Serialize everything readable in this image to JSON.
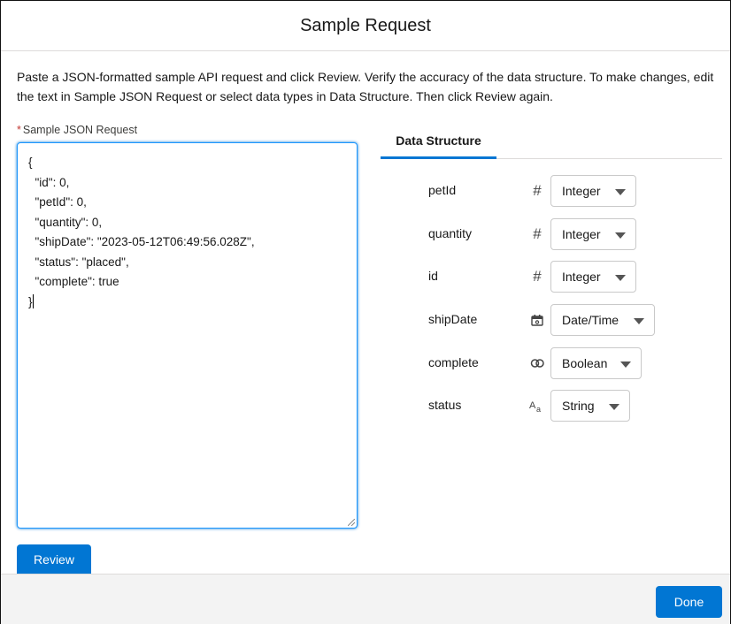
{
  "modal": {
    "title": "Sample Request",
    "instructions": "Paste a JSON-formatted sample API request and click Review. Verify the accuracy of the data structure. To make changes, edit the text in Sample JSON Request or select data types in Data Structure. Then click Review again."
  },
  "json_field": {
    "required_marker": "*",
    "label": "Sample JSON Request",
    "value": "{\n  \"id\": 0,\n  \"petId\": 0,\n  \"quantity\": 0,\n  \"shipDate\": \"2023-05-12T06:49:56.028Z\",\n  \"status\": \"placed\",\n  \"complete\": true\n}"
  },
  "tabs": [
    {
      "label": "Data Structure",
      "active": true
    }
  ],
  "data_structure": [
    {
      "name": "petId",
      "icon": "hash-icon",
      "glyph": "#",
      "type": "Integer"
    },
    {
      "name": "quantity",
      "icon": "hash-icon",
      "glyph": "#",
      "type": "Integer"
    },
    {
      "name": "id",
      "icon": "hash-icon",
      "glyph": "#",
      "type": "Integer"
    },
    {
      "name": "shipDate",
      "icon": "calendar-icon",
      "glyph": "",
      "type": "Date/Time"
    },
    {
      "name": "complete",
      "icon": "boolean-rings-icon",
      "glyph": "",
      "type": "Boolean"
    },
    {
      "name": "status",
      "icon": "text-type-icon",
      "glyph": "",
      "type": "String"
    }
  ],
  "buttons": {
    "review": "Review",
    "done": "Done"
  },
  "colors": {
    "brand": "#0176d3",
    "required": "#c23934",
    "footer_bg": "#f3f3f3"
  }
}
